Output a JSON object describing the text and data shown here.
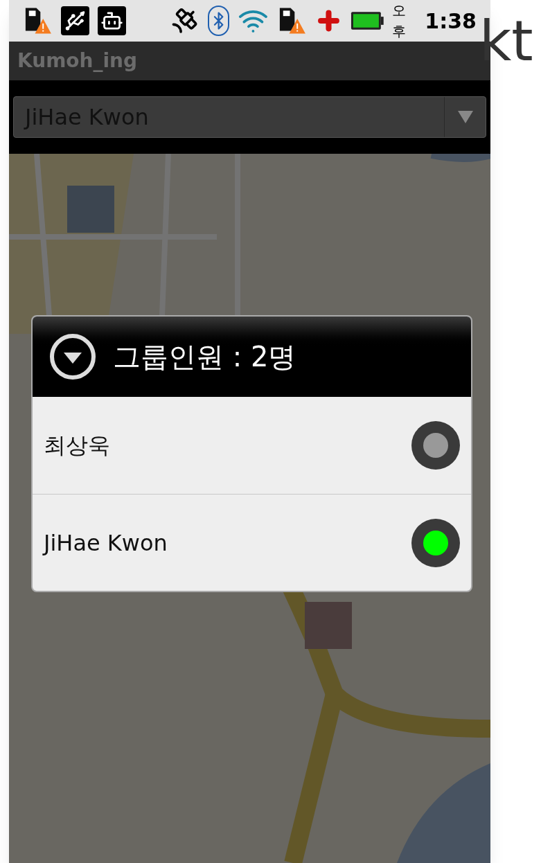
{
  "status_bar": {
    "time_period": "오후",
    "time": "1:38"
  },
  "app_bar": {
    "title": "Kumoh_ing"
  },
  "spinner": {
    "value": "JiHae Kwon"
  },
  "dialog": {
    "title": "그룹인원 : 2명",
    "members": [
      {
        "name": "최상욱",
        "selected": false
      },
      {
        "name": "JiHae Kwon",
        "selected": true
      }
    ]
  },
  "logo": {
    "text": "kt"
  }
}
